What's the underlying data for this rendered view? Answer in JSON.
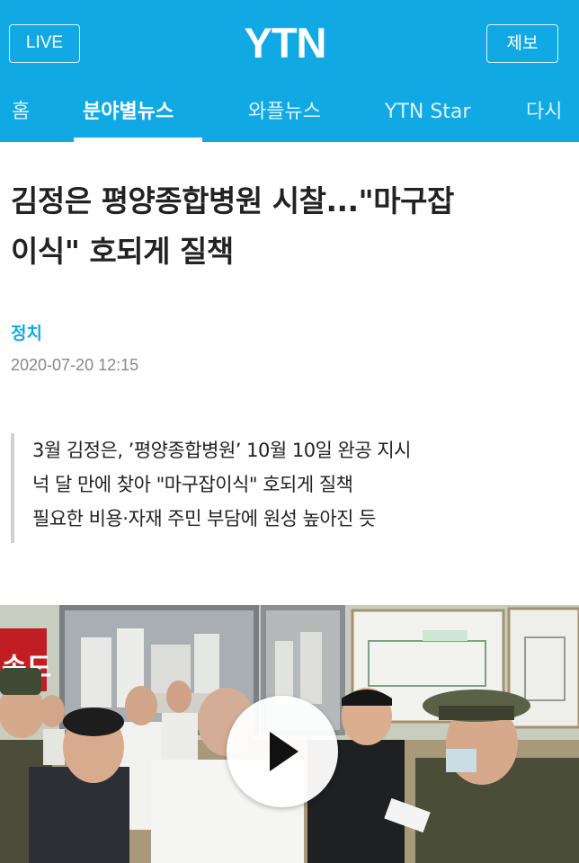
{
  "header": {
    "live_label": "LIVE",
    "logo_text": "YTN",
    "report_label": "제보",
    "brand_color": "#11a9e4"
  },
  "nav": {
    "items": [
      {
        "label": "홈"
      },
      {
        "label": "분야별뉴스",
        "active": true
      },
      {
        "label": "와플뉴스"
      },
      {
        "label": "YTN Star"
      },
      {
        "label": "다시"
      }
    ]
  },
  "article": {
    "title_line1": "김정은 평양종합병원 시찰...\"마구잡",
    "title_line2": "이식\" 호되게 질책",
    "category": "정치",
    "date": "2020-07-20 12:15",
    "summary": [
      "3월 김정은, ’평양종합병원’ 10월 10일 완공 지시",
      "넉 달 만에 찾아 \"마구잡이식\" 호되게 질책",
      "필요한 비용·자재 주민 부담에 원성 높아진 듯"
    ]
  },
  "media": {
    "play_icon": "play-icon"
  }
}
